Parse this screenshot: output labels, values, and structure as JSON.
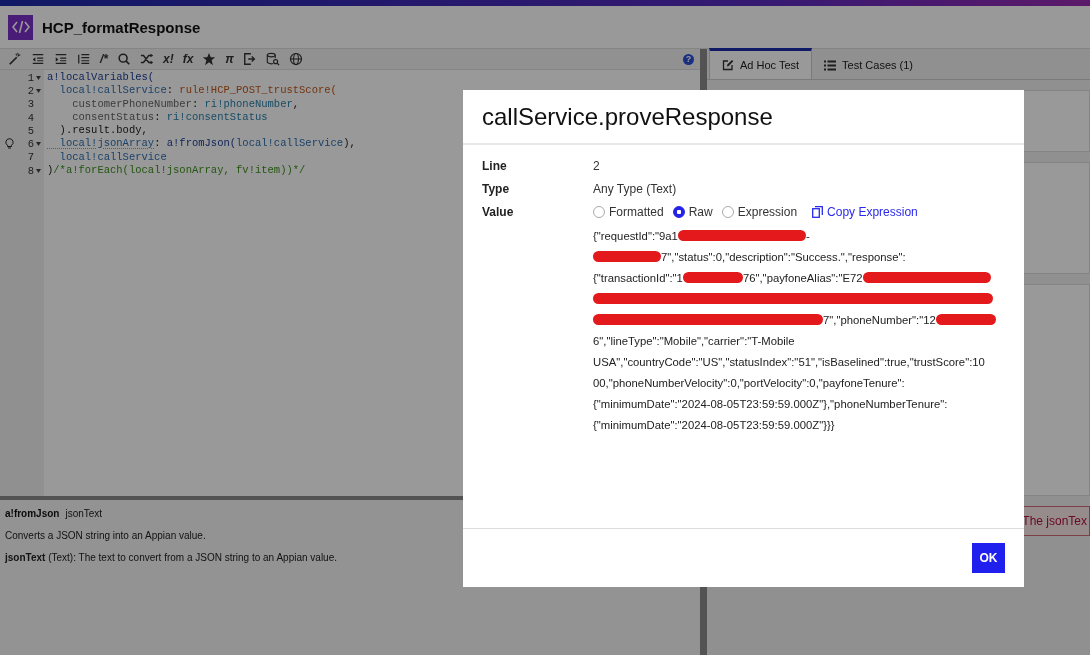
{
  "header": {
    "title": "HCP_formatResponse"
  },
  "toolbar": [
    {
      "kind": "icon"
    },
    {
      "kind": "icon"
    },
    {
      "kind": "icon"
    },
    {
      "kind": "icon"
    },
    {
      "kind": "glyph",
      "text": "/*"
    },
    {
      "kind": "icon"
    },
    {
      "kind": "icon"
    },
    {
      "kind": "glyph",
      "text": "x!"
    },
    {
      "kind": "glyph",
      "text": "fx"
    },
    {
      "kind": "icon"
    },
    {
      "kind": "glyph",
      "text": "π"
    },
    {
      "kind": "icon"
    },
    {
      "kind": "icon"
    },
    {
      "kind": "icon"
    }
  ],
  "help": "?",
  "code": [
    {
      "number": "1",
      "fold": true,
      "hint": false,
      "tokens": [
        {
          "kind": "fn",
          "text": "a!localVariables("
        }
      ]
    },
    {
      "number": "2",
      "fold": true,
      "hint": false,
      "tokens": [
        {
          "kind": "local",
          "text": "  local!callService"
        },
        {
          "kind": "plain",
          "text": ": "
        },
        {
          "kind": "rule",
          "text": "rule!HCP_POST_trustScore("
        }
      ]
    },
    {
      "number": "3",
      "fold": false,
      "hint": false,
      "tokens": [
        {
          "kind": "param",
          "text": "    customerPhoneNumber"
        },
        {
          "kind": "plain",
          "text": ": "
        },
        {
          "kind": "ri",
          "text": "ri!phoneNumber"
        },
        {
          "kind": "plain",
          "text": ","
        }
      ]
    },
    {
      "number": "4",
      "fold": false,
      "hint": false,
      "tokens": [
        {
          "kind": "param",
          "text": "    consentStatus"
        },
        {
          "kind": "plain",
          "text": ": "
        },
        {
          "kind": "ri",
          "text": "ri!consentStatus"
        }
      ]
    },
    {
      "number": "5",
      "fold": false,
      "hint": false,
      "tokens": [
        {
          "kind": "plain",
          "text": "  ).result.body,"
        }
      ]
    },
    {
      "number": "6",
      "fold": true,
      "hint": true,
      "tokens": [
        {
          "kind": "warn",
          "text": "  local!jsonArray"
        },
        {
          "kind": "plain",
          "text": ": "
        },
        {
          "kind": "fn",
          "text": "a!fromJson("
        },
        {
          "kind": "local",
          "text": "local!callService"
        },
        {
          "kind": "plain",
          "text": "),"
        }
      ]
    },
    {
      "number": "7",
      "fold": false,
      "hint": false,
      "tokens": [
        {
          "kind": "local",
          "text": "  local!callService"
        }
      ]
    },
    {
      "number": "8",
      "fold": true,
      "hint": false,
      "tokens": [
        {
          "kind": "plain",
          "text": ")"
        },
        {
          "kind": "comment",
          "text": "/*a!forEach(local!jsonArray, fv!item))*/"
        }
      ]
    }
  ],
  "help_pane": {
    "signature_name": "a!fromJson",
    "signature_param": "jsonText",
    "description": "Converts a JSON string into an Appian value.",
    "parameter": "**jsonText** (Text): The text to convert from a JSON string to an Appian value."
  },
  "tabs": [
    {
      "label": "Ad Hoc Test",
      "selected": true
    },
    {
      "label": "Test Cases (1)",
      "selected": false
    }
  ],
  "error_text": "The jsonTex",
  "dialog": {
    "title": "callService.proveResponse",
    "fields": [
      {
        "label": "Line",
        "value": "2"
      },
      {
        "label": "Type",
        "value": "Any Type (Text)"
      }
    ],
    "value_label": "Value",
    "options": [
      {
        "label": "Formatted",
        "selected": false
      },
      {
        "label": "Raw",
        "selected": true
      },
      {
        "label": "Expression",
        "selected": false
      }
    ],
    "copy_link": "Copy Expression",
    "value_lines": [
      [
        {
          "kind": "text",
          "text": "{\"requestId\":\"9a1"
        },
        {
          "kind": "redacted"
        },
        {
          "kind": "text",
          "text": "-"
        }
      ],
      [
        {
          "kind": "redacted"
        },
        {
          "kind": "text",
          "text": "7\",\"status\":0,\"description\":\"Success.\",\"response\":"
        }
      ],
      [
        {
          "kind": "text",
          "text": "{\"transactionId\":\"1"
        },
        {
          "kind": "redacted"
        },
        {
          "kind": "text",
          "text": "76\",\"payfoneAlias\":\"E72"
        },
        {
          "kind": "redacted"
        }
      ],
      [
        {
          "kind": "redacted"
        }
      ],
      [
        {
          "kind": "redacted"
        },
        {
          "kind": "text",
          "text": "7\",\"phoneNumber\":\"12"
        },
        {
          "kind": "redacted"
        }
      ],
      [
        {
          "kind": "text",
          "text": "6\",\"lineType\":\"Mobile\",\"carrier\":\"T-Mobile"
        }
      ],
      [
        {
          "kind": "text",
          "text": "USA\",\"countryCode\":\"US\",\"statusIndex\":\"51\",\"isBaselined\":true,\"trustScore\":10"
        }
      ],
      [
        {
          "kind": "text",
          "text": "00,\"phoneNumberVelocity\":0,\"portVelocity\":0,\"payfoneTenure\":"
        }
      ],
      [
        {
          "kind": "text",
          "text": "{\"minimumDate\":\"2024-08-05T23:59:59.000Z\"},\"phoneNumberTenure\":"
        }
      ],
      [
        {
          "kind": "text",
          "text": "{\"minimumDate\":\"2024-08-05T23:59:59.000Z\"}}}"
        }
      ]
    ],
    "ok_button": "OK"
  }
}
